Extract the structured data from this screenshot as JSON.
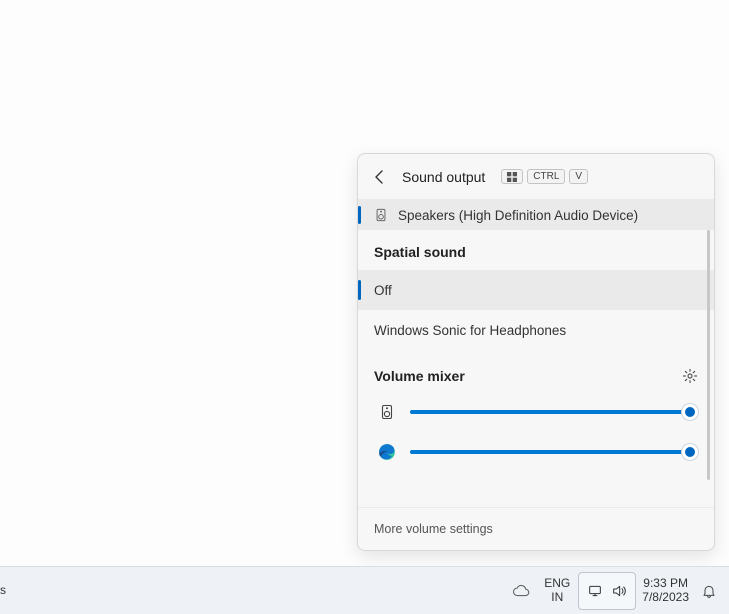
{
  "flyout": {
    "title": "Sound output",
    "keyhint_ctrl": "CTRL",
    "keyhint_v": "V",
    "selected_output": "Speakers (High Definition Audio Device)",
    "spatial": {
      "heading": "Spatial sound",
      "options": [
        "Off",
        "Windows Sonic for Headphones"
      ],
      "selected_index": 0
    },
    "mixer": {
      "heading": "Volume mixer",
      "rows": [
        {
          "icon": "speaker",
          "value": 100
        },
        {
          "icon": "edge",
          "value": 100
        }
      ]
    },
    "footer_link": "More volume settings"
  },
  "taskbar": {
    "lang_top": "ENG",
    "lang_bottom": "IN",
    "time": "9:33 PM",
    "date": "7/8/2023",
    "left_stub": "s"
  }
}
